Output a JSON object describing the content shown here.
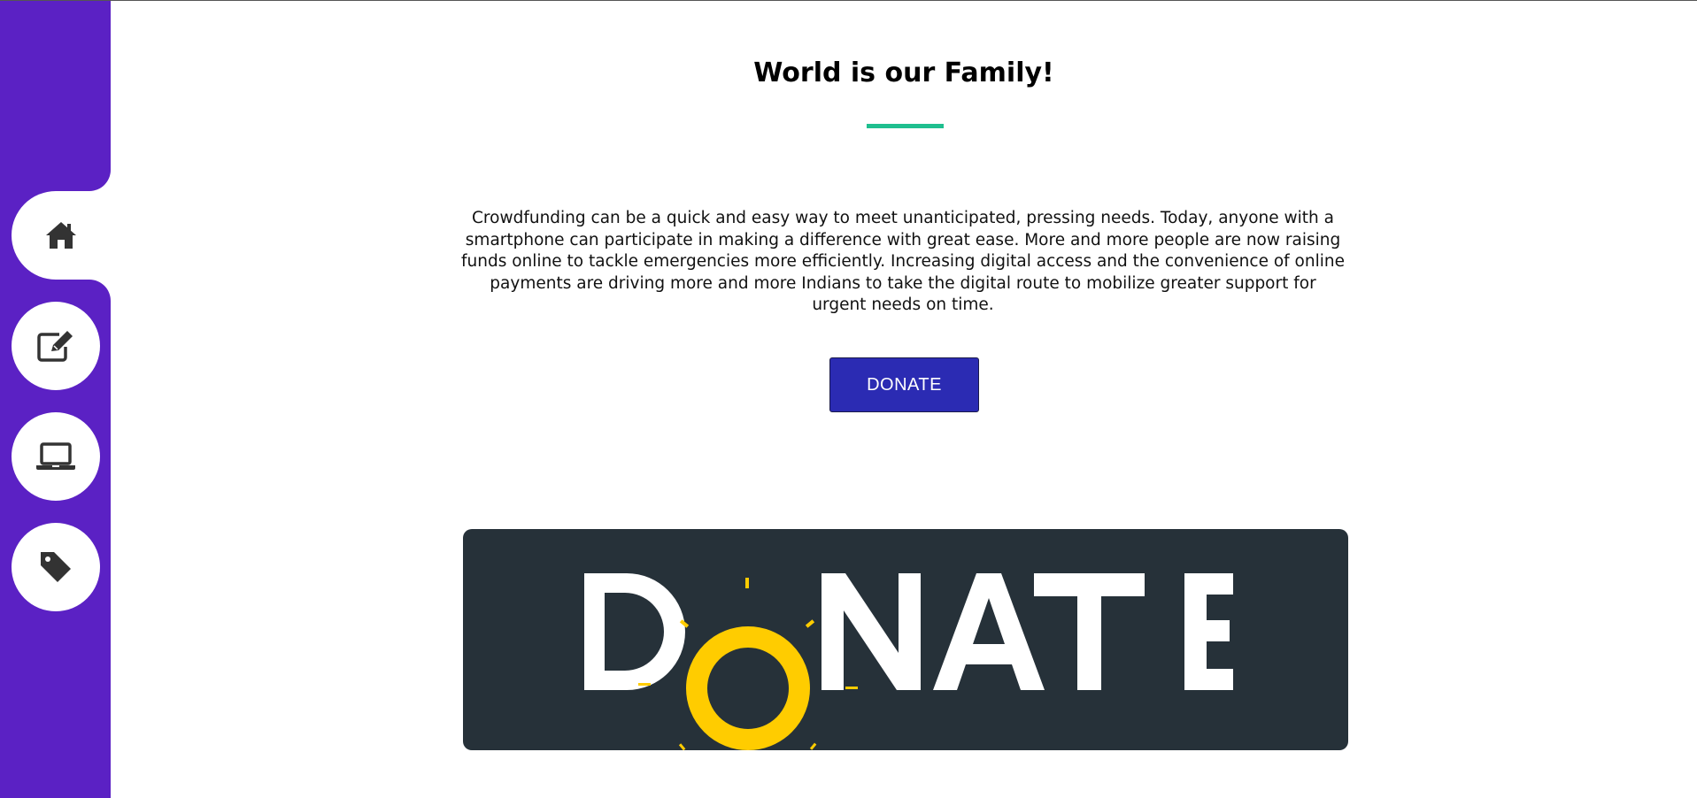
{
  "sidebar": {
    "background_color": "#5b21c4",
    "items": [
      {
        "icon": "home-icon",
        "active": true
      },
      {
        "icon": "edit-icon",
        "active": false
      },
      {
        "icon": "laptop-icon",
        "active": false
      },
      {
        "icon": "tag-icon",
        "active": false
      }
    ]
  },
  "main": {
    "title": "World is our Family!",
    "underline_color": "#1fbf8f",
    "description": "Crowdfunding can be a quick and easy way to meet unanticipated, pressing needs. Today, anyone with a smartphone can participate in making a difference with great ease. More and more people are now raising funds online to tackle emergencies more efficiently. Increasing digital access and the convenience of online payments are driving more and more Indians to take the digital route to mobilize greater support for urgent needs on time.",
    "donate_button_label": "DONATE",
    "donate_button_color": "#2b2bb3"
  },
  "banner": {
    "text": "DONATE",
    "background_color": "#263139",
    "letter_color": "#ffffff",
    "accent_color": "#ffcc00"
  }
}
